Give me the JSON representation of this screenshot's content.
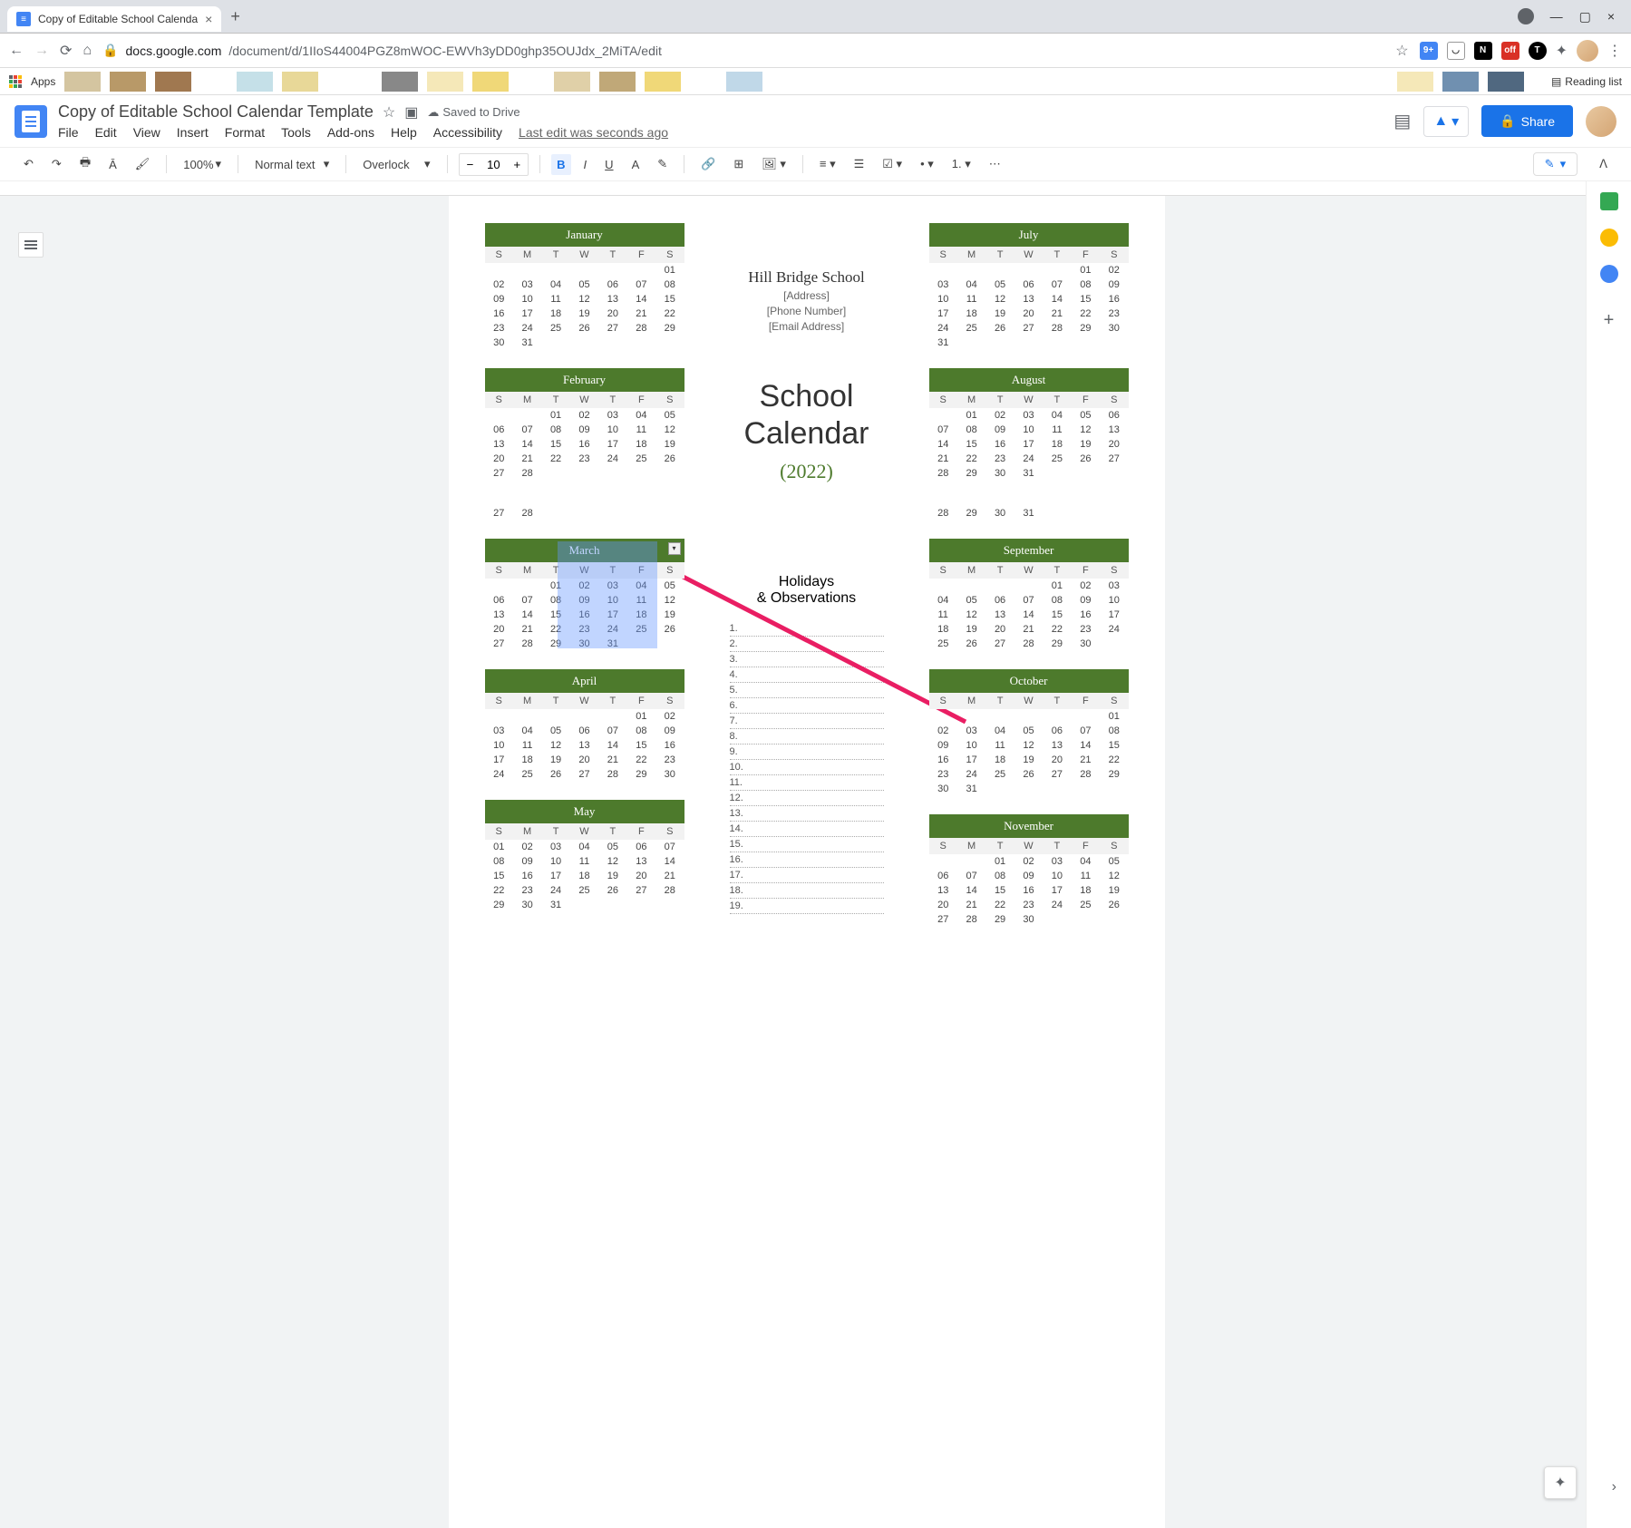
{
  "browser": {
    "tab_title": "Copy of Editable School Calenda",
    "url_domain": "docs.google.com",
    "url_path": "/document/d/1IIoS44004PGZ8mWOC-EWVh3yDD0ghp35OUJdx_2MiTA/edit",
    "bookmarks_apps": "Apps",
    "reading_list": "Reading list",
    "ext_badge": "9+"
  },
  "docs": {
    "title": "Copy of Editable School Calendar Template",
    "saved": "Saved to Drive",
    "menus": [
      "File",
      "Edit",
      "View",
      "Insert",
      "Format",
      "Tools",
      "Add-ons",
      "Help",
      "Accessibility"
    ],
    "last_edit": "Last edit was seconds ago",
    "share": "Share"
  },
  "toolbar": {
    "zoom": "100%",
    "style": "Normal text",
    "font": "Overlock",
    "font_size": "10"
  },
  "content": {
    "school_name": "Hill Bridge School",
    "address": "[Address]",
    "phone": "[Phone Number]",
    "email": "[Email Address]",
    "title1": "School",
    "title2": "Calendar",
    "year": "(2022)",
    "holidays_title1": "Holidays",
    "holidays_title2": "& Observations",
    "day_headers": [
      "S",
      "M",
      "T",
      "W",
      "T",
      "F",
      "S"
    ],
    "months_left": [
      {
        "name": "January",
        "start": 6,
        "days": 31
      },
      {
        "name": "February",
        "start": 2,
        "days": 28
      },
      {
        "name": "March",
        "start": 2,
        "days": 31,
        "selected": true
      },
      {
        "name": "April",
        "start": 5,
        "days": 30
      },
      {
        "name": "May",
        "start": 0,
        "days": 31
      }
    ],
    "months_right": [
      {
        "name": "July",
        "start": 5,
        "days": 31
      },
      {
        "name": "August",
        "start": 1,
        "days": 31
      },
      {
        "name": "September",
        "start": 4,
        "days": 30
      },
      {
        "name": "October",
        "start": 6,
        "days": 31
      },
      {
        "name": "November",
        "start": 2,
        "days": 30
      }
    ],
    "feb_extra_row": [
      "27",
      "28",
      "",
      "",
      "",
      "",
      ""
    ],
    "aug_extra_row": [
      "28",
      "29",
      "30",
      "31",
      "",
      "",
      ""
    ],
    "holiday_numbers": [
      "1.",
      "2.",
      "3.",
      "4.",
      "5.",
      "6.",
      "7.",
      "8.",
      "9.",
      "10.",
      "11.",
      "12.",
      "13.",
      "14.",
      "15.",
      "16.",
      "17.",
      "18.",
      "19."
    ]
  }
}
